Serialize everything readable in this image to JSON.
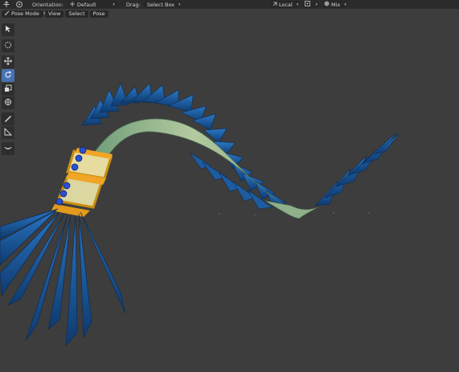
{
  "header": {
    "orientation_label": "Orientation:",
    "orientation_value": "Default",
    "drag_label": "Drag:",
    "drag_value": "Select Box",
    "pivot_value": "Local",
    "mix_value": "Mix"
  },
  "subheader": {
    "mode": "Pose Mode",
    "menus": [
      "View",
      "Select",
      "Pose"
    ]
  },
  "tools": [
    {
      "icon": "cursor-icon"
    },
    {
      "icon": "select-circle-icon"
    },
    {
      "icon": "move-icon"
    },
    {
      "icon": "rotate-icon",
      "active": true
    },
    {
      "icon": "scale-icon"
    },
    {
      "icon": "transform-icon"
    },
    {
      "icon": "annotate-icon"
    },
    {
      "icon": "measure-icon"
    },
    {
      "icon": "relax-icon"
    }
  ],
  "colors": {
    "accent": "#4772b3",
    "viewport_bg": "#3d3d3d",
    "feather_blue": "#1f5fa8",
    "serpent_green": "#a9c39a",
    "gold": "#e39a1c"
  }
}
